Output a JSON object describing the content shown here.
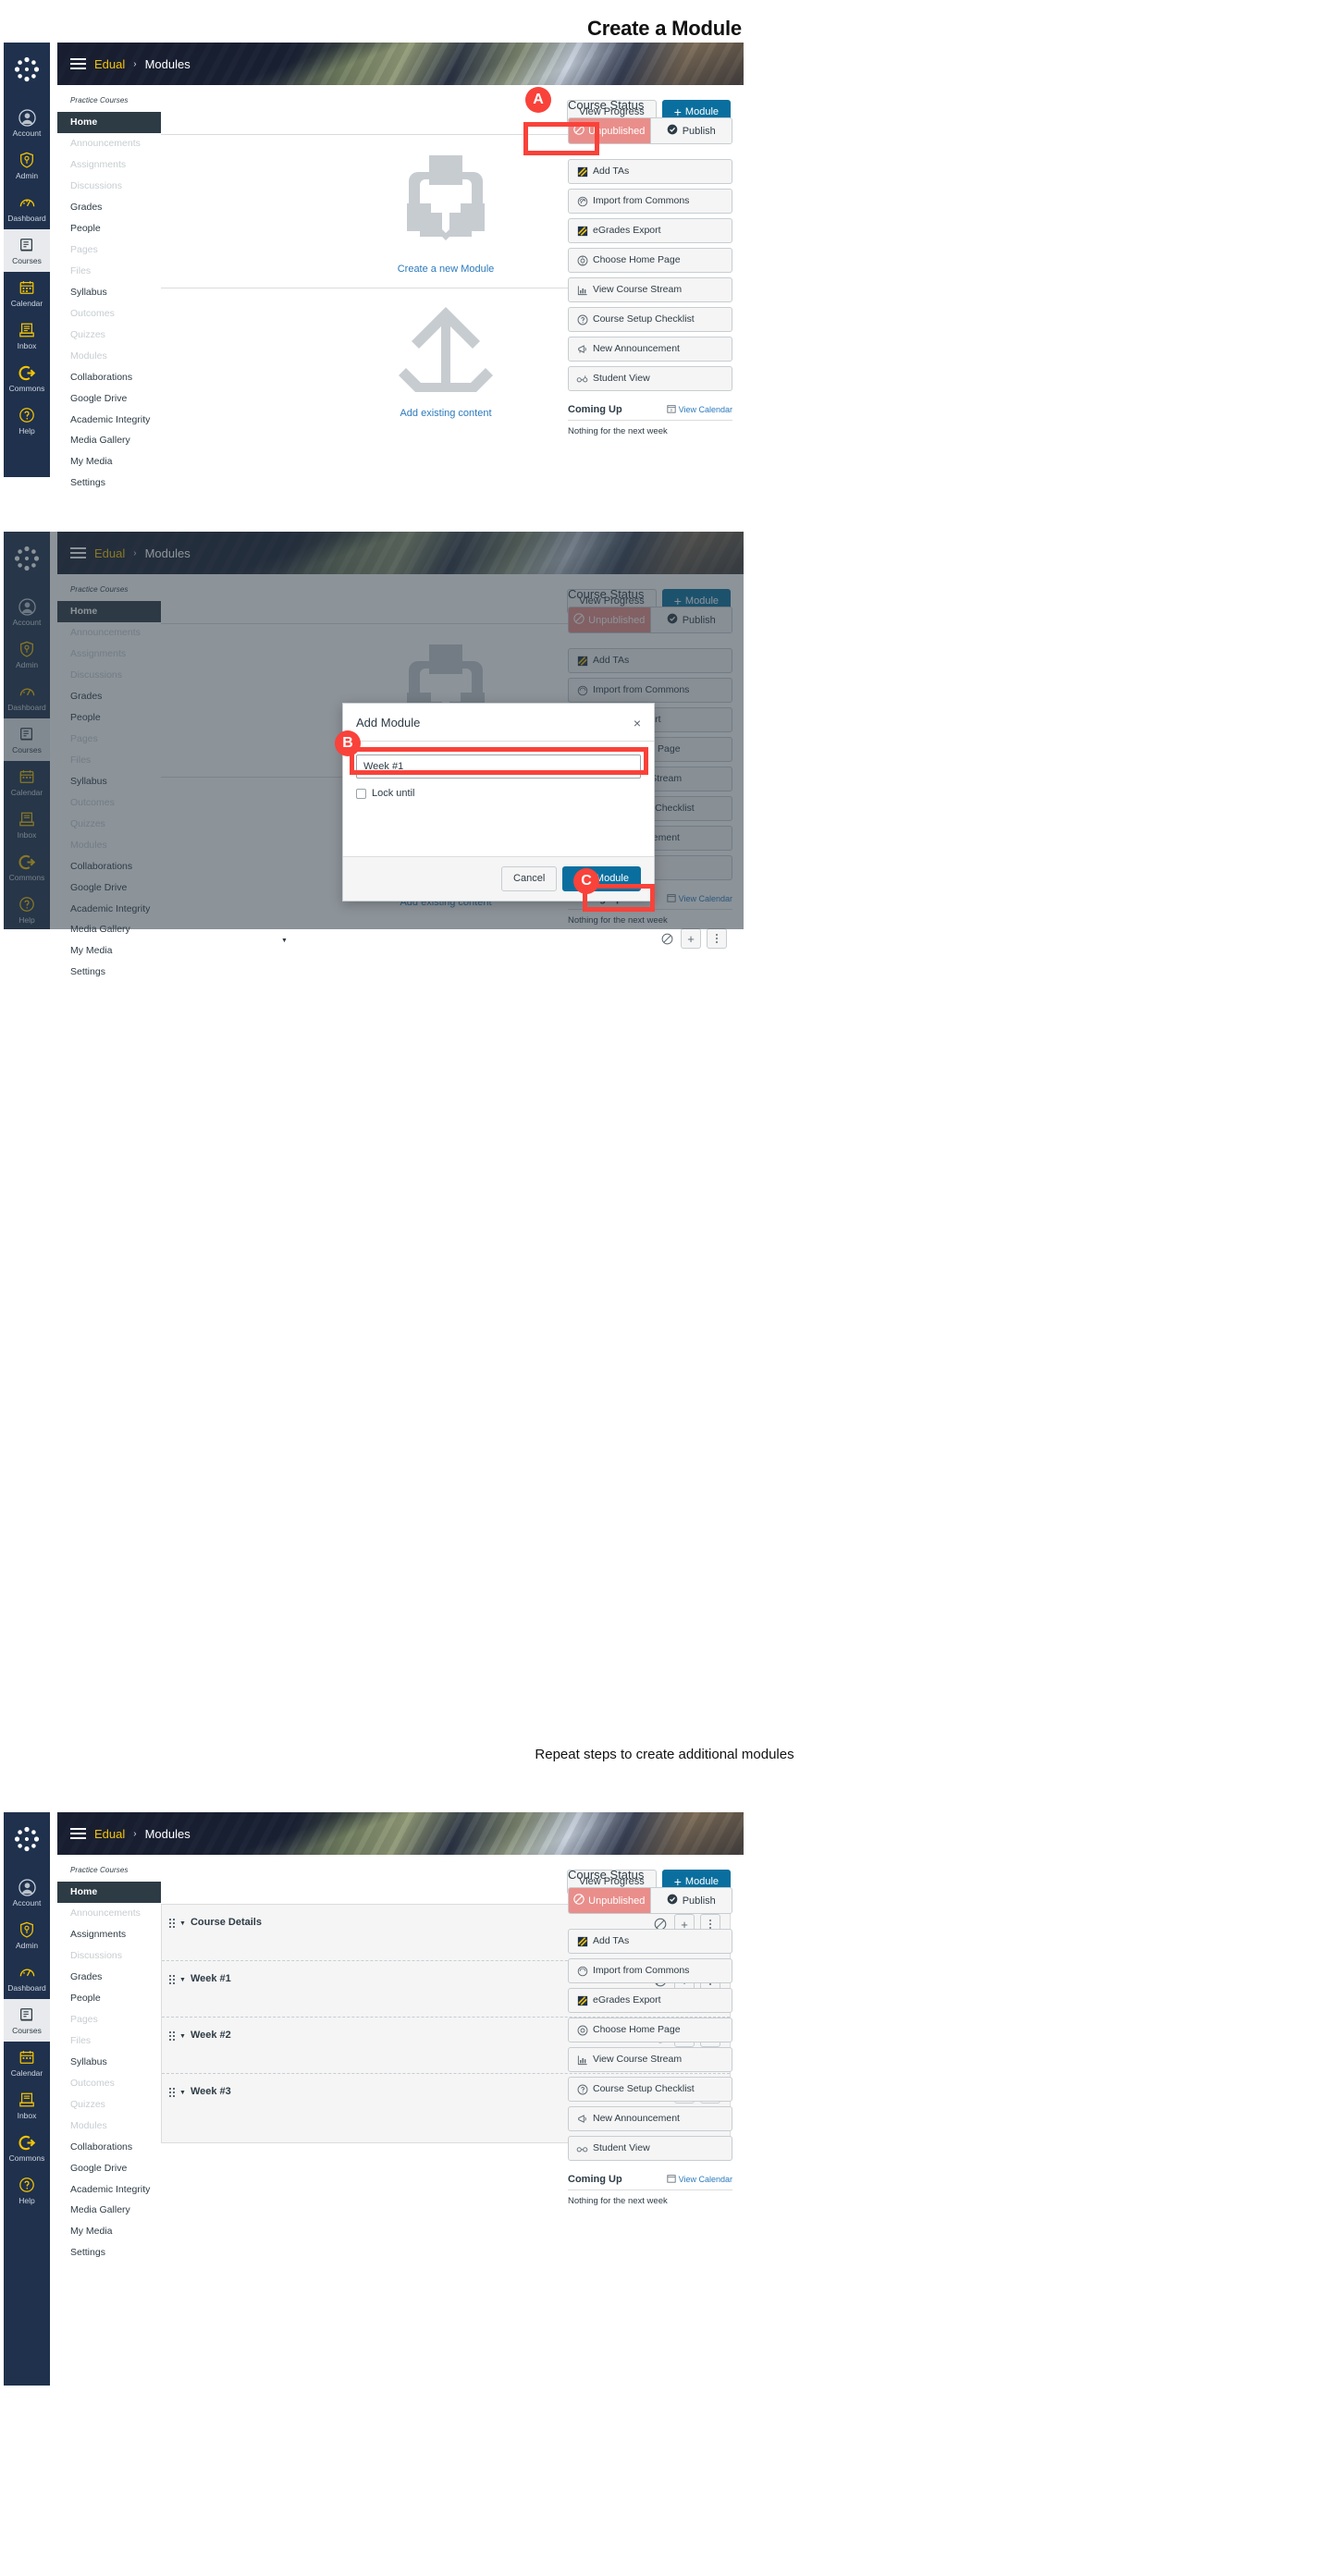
{
  "page": {
    "title": "Create a Module",
    "repeat_caption": "Repeat steps to create additional modules"
  },
  "global_nav": {
    "items": [
      {
        "label": "Account",
        "icon": "account-avatar-icon"
      },
      {
        "label": "Admin",
        "icon": "shield-key-icon"
      },
      {
        "label": "Dashboard",
        "icon": "gauge-icon"
      },
      {
        "label": "Courses",
        "icon": "book-icon"
      },
      {
        "label": "Calendar",
        "icon": "calendar-icon"
      },
      {
        "label": "Inbox",
        "icon": "inbox-icon"
      },
      {
        "label": "Commons",
        "icon": "commons-arrow-icon"
      },
      {
        "label": "Help",
        "icon": "question-circle-icon"
      }
    ],
    "active_label": "Courses"
  },
  "breadcrumb": {
    "course": "Edual",
    "separator": "›",
    "page": "Modules"
  },
  "course_nav": {
    "heading": "Practice Courses",
    "items": [
      {
        "label": "Home",
        "state": "active"
      },
      {
        "label": "Announcements",
        "state": "dim"
      },
      {
        "label": "Assignments",
        "state": "dim"
      },
      {
        "label": "Discussions",
        "state": "dim"
      },
      {
        "label": "Grades",
        "state": "dark"
      },
      {
        "label": "People",
        "state": "dark"
      },
      {
        "label": "Pages",
        "state": "dim"
      },
      {
        "label": "Files",
        "state": "dim"
      },
      {
        "label": "Syllabus",
        "state": "dark"
      },
      {
        "label": "Outcomes",
        "state": "dim"
      },
      {
        "label": "Quizzes",
        "state": "dim"
      },
      {
        "label": "Modules",
        "state": "dim"
      },
      {
        "label": "Collaborations",
        "state": "dark"
      },
      {
        "label": "Google Drive",
        "state": "dark"
      },
      {
        "label": "Academic Integrity",
        "state": "dark"
      },
      {
        "label": "Media Gallery",
        "state": "dark"
      },
      {
        "label": "My Media",
        "state": "dark"
      },
      {
        "label": "Settings",
        "state": "dark"
      }
    ]
  },
  "toolbar": {
    "view_progress": "View Progress",
    "add_module": "Module",
    "plus": "+"
  },
  "empty_state": {
    "create_new": "Create a new Module",
    "add_existing": "Add existing content"
  },
  "right_rail": {
    "title": "Course Status",
    "unpublished": "Unpublished",
    "publish": "Publish",
    "buttons": [
      {
        "label": "Add TAs",
        "icon": "grades-pencil-icon"
      },
      {
        "label": "Import from Commons",
        "icon": "commons-icon"
      },
      {
        "label": "eGrades Export",
        "icon": "grades-pencil-icon"
      },
      {
        "label": "Choose Home Page",
        "icon": "target-icon"
      },
      {
        "label": "View Course Stream",
        "icon": "chart-icon"
      },
      {
        "label": "Course Setup Checklist",
        "icon": "question-circle-icon"
      },
      {
        "label": "New Announcement",
        "icon": "megaphone-icon"
      },
      {
        "label": "Student View",
        "icon": "glasses-icon"
      }
    ],
    "coming_up": "Coming Up",
    "view_calendar": "View Calendar",
    "nothing": "Nothing for the next week"
  },
  "modal": {
    "title": "Add Module",
    "close": "×",
    "input_value": "Week #1",
    "input_placeholder": "",
    "lock_until": "Lock until",
    "cancel": "Cancel",
    "submit": "Add Module"
  },
  "annotations": [
    {
      "id": "A",
      "target": "add-module-button"
    },
    {
      "id": "B",
      "target": "module-name-input"
    },
    {
      "id": "C",
      "target": "add-module-submit"
    }
  ],
  "modules": [
    {
      "name": "Course Details"
    },
    {
      "name": "Week #1"
    },
    {
      "name": "Week #2"
    },
    {
      "name": "Week #3"
    }
  ],
  "colors": {
    "brand_blue": "#0a6f9e",
    "link_blue": "#2b7abc",
    "nav_dark": "#1f314d",
    "annotation_red": "#f9423a",
    "unpublished_red": "#e98e8b",
    "accent_gold": "#f5c400"
  }
}
